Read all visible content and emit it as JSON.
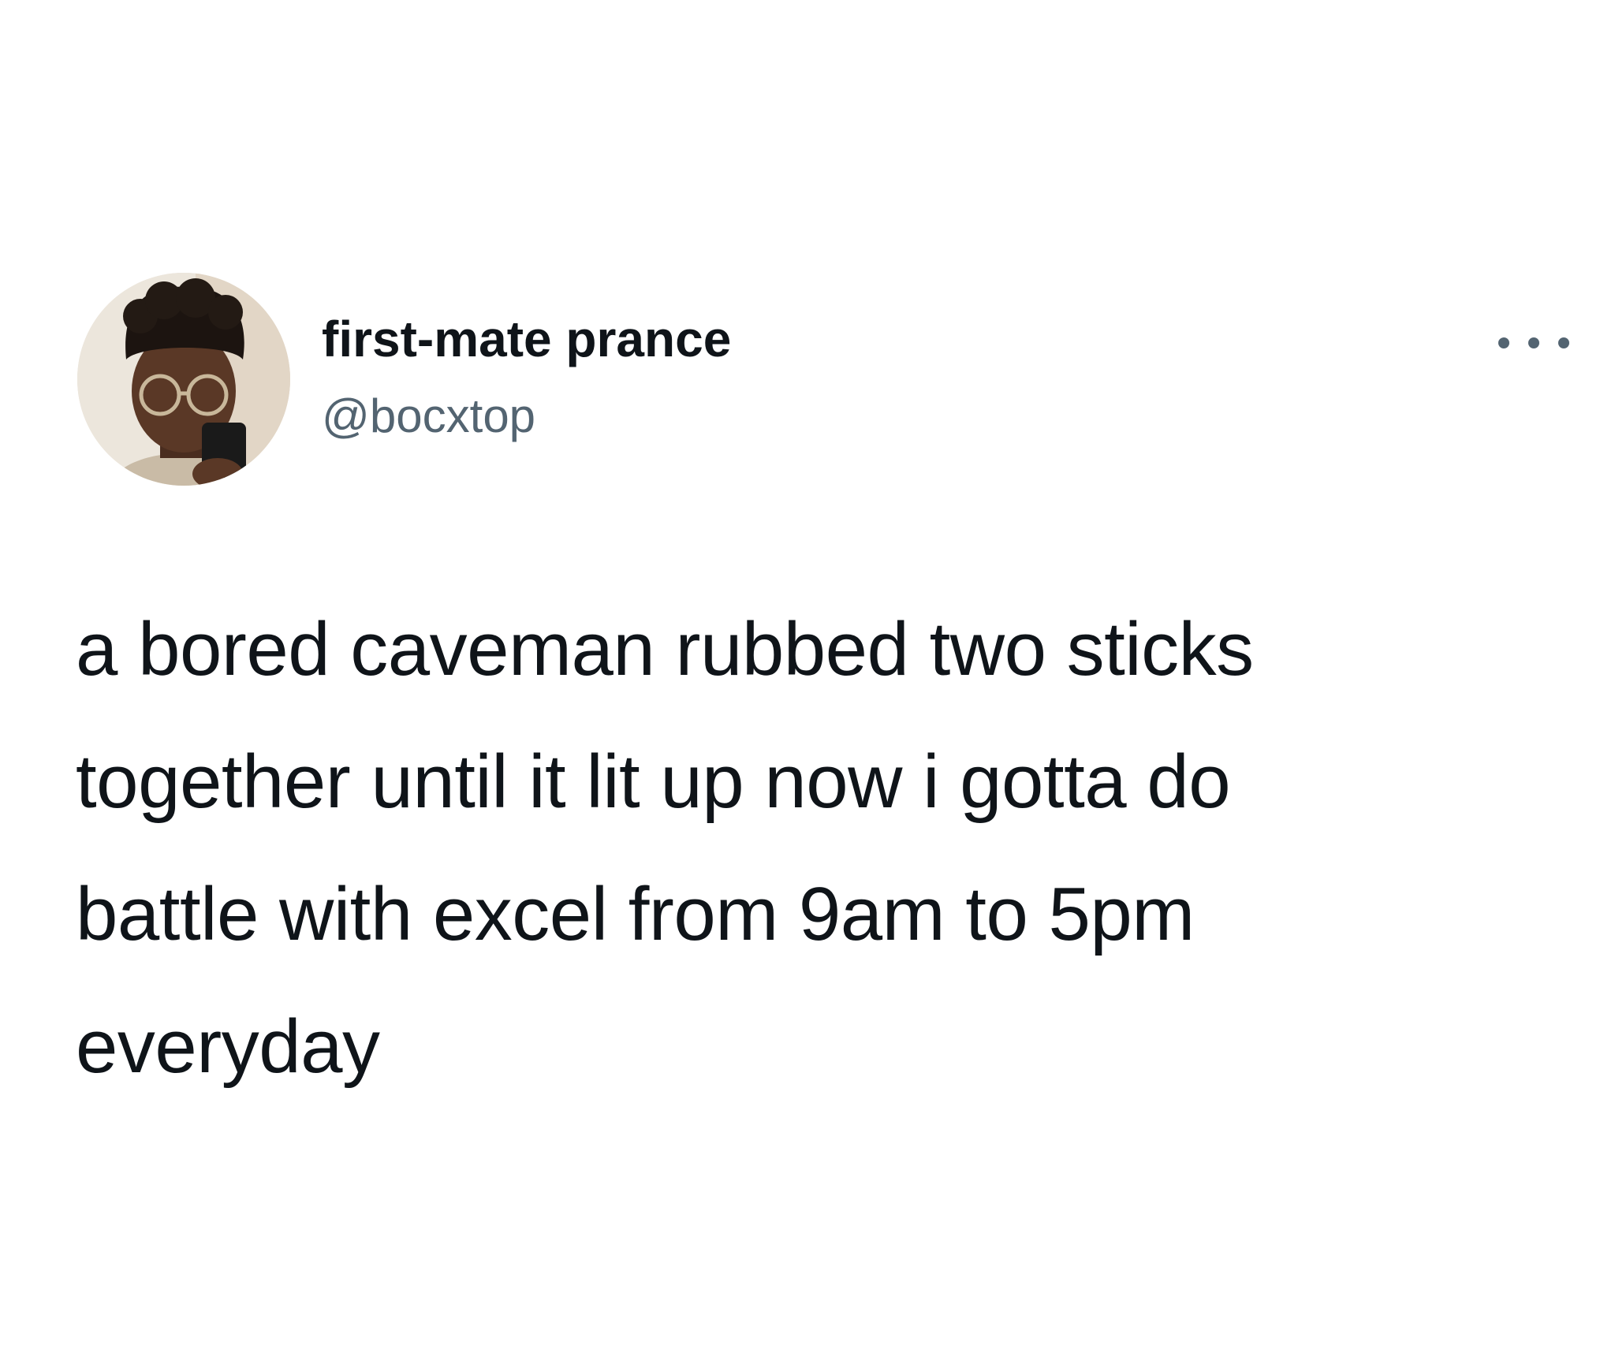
{
  "tweet": {
    "author": {
      "display_name": "first-mate prance",
      "handle": "@bocxtop"
    },
    "text_lines": [
      "a bored caveman rubbed two sticks",
      "together until it lit up now i gotta do",
      "battle with excel from 9am to 5pm",
      "everyday"
    ],
    "more_icon": "more-horizontal-icon"
  },
  "colors": {
    "background": "#ffffff",
    "primary_text": "#0f1419",
    "secondary_text": "#536471"
  }
}
